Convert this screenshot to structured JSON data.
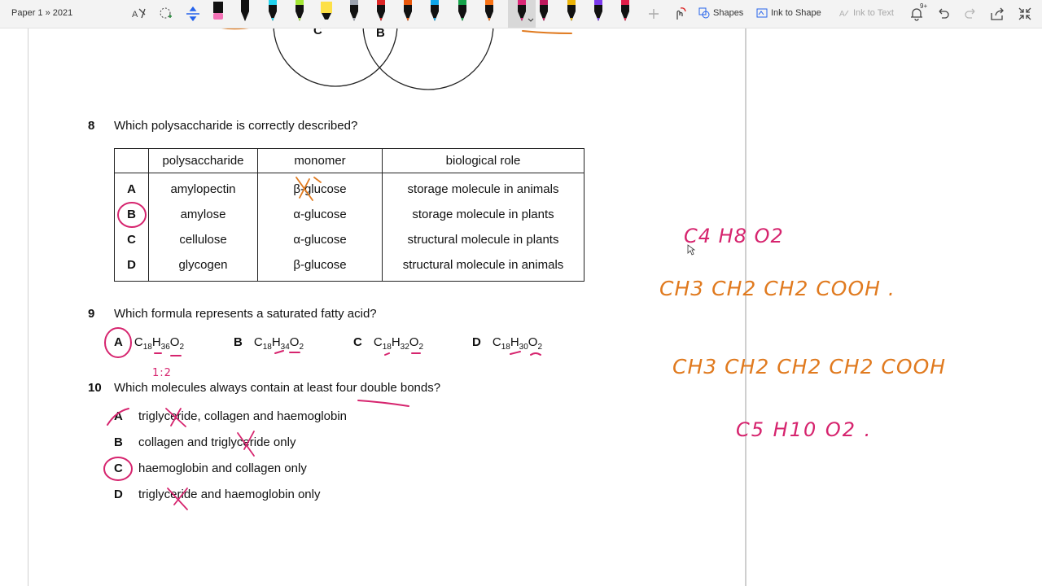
{
  "breadcrumb": "Paper 1 » 2021",
  "toolbar": {
    "shapes_label": "Shapes",
    "ink_to_shape_label": "Ink to Shape",
    "ink_to_text_label": "Ink to Text",
    "notification_badge": "9+",
    "pens": [
      {
        "color": "#f472b6",
        "kind": "eraser"
      },
      {
        "color": "#111111",
        "kind": "pen"
      },
      {
        "color": "#22d3ee",
        "kind": "pen"
      },
      {
        "color": "#a3e635",
        "kind": "pen"
      },
      {
        "color": "#fde047",
        "kind": "highlighter"
      },
      {
        "color": "#9ca3af",
        "kind": "pen"
      },
      {
        "color": "#dc2626",
        "kind": "pen"
      },
      {
        "color": "#ea580c",
        "kind": "pen"
      },
      {
        "color": "#0ea5e9",
        "kind": "pen"
      },
      {
        "color": "#16a34a",
        "kind": "pen"
      },
      {
        "color": "#f97316",
        "kind": "pen"
      },
      {
        "color": "#db2777",
        "kind": "pen",
        "selected": true
      },
      {
        "color": "#be185d",
        "kind": "pen"
      },
      {
        "color": "#eab308",
        "kind": "pen"
      },
      {
        "color": "#7c3aed",
        "kind": "pen"
      },
      {
        "color": "#e11d48",
        "kind": "pen"
      }
    ]
  },
  "venn": {
    "label_c": "C",
    "label_b": "B"
  },
  "q8": {
    "number": "8",
    "text": "Which polysaccharide is correctly described?",
    "headers": [
      "polysaccharide",
      "monomer",
      "biological role"
    ],
    "rows": [
      {
        "letter": "A",
        "poly": "amylopectin",
        "monomer": "β-glucose",
        "role": "storage molecule in animals"
      },
      {
        "letter": "B",
        "poly": "amylose",
        "monomer": "α-glucose",
        "role": "storage molecule in plants"
      },
      {
        "letter": "C",
        "poly": "cellulose",
        "monomer": "α-glucose",
        "role": "structural molecule in plants"
      },
      {
        "letter": "D",
        "poly": "glycogen",
        "monomer": "β-glucose",
        "role": "structural molecule in animals"
      }
    ]
  },
  "q9": {
    "number": "9",
    "text": "Which formula represents a saturated fatty acid?",
    "options": [
      {
        "letter": "A",
        "c": "C",
        "cn": "18",
        "h": "H",
        "hn": "36",
        "o": "O",
        "on": "2"
      },
      {
        "letter": "B",
        "c": "C",
        "cn": "18",
        "h": "H",
        "hn": "34",
        "o": "O",
        "on": "2"
      },
      {
        "letter": "C",
        "c": "C",
        "cn": "18",
        "h": "H",
        "hn": "32",
        "o": "O",
        "on": "2"
      },
      {
        "letter": "D",
        "c": "C",
        "cn": "18",
        "h": "H",
        "hn": "30",
        "o": "O",
        "on": "2"
      }
    ]
  },
  "q10": {
    "number": "10",
    "text": "Which molecules always contain at least four double bonds?",
    "options": [
      {
        "letter": "A",
        "text": "triglyceride, collagen and haemoglobin"
      },
      {
        "letter": "B",
        "text": "collagen and triglyceride only"
      },
      {
        "letter": "C",
        "text": "haemoglobin and collagen only"
      },
      {
        "letter": "D",
        "text": "triglyceride and haemoglobin only"
      }
    ]
  },
  "handwriting": {
    "ratio_note": "1:2",
    "formula1": "C4 H8 O2",
    "formula2": "CH3 CH2 CH2 COOH .",
    "formula3": "CH3 CH2 CH2 CH2 COOH",
    "formula4": "C5 H10 O2 ."
  },
  "colors": {
    "ink_pink": "#d6246e",
    "ink_orange": "#e07a1f"
  }
}
